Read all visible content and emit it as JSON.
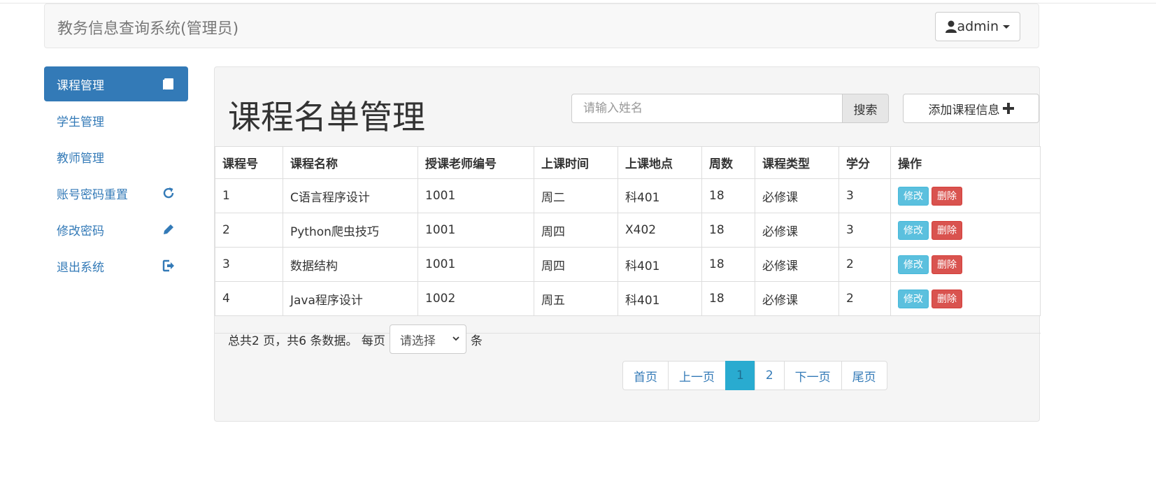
{
  "header": {
    "brand": "教务信息查询系统(管理员)",
    "user_label": "admin"
  },
  "sidebar": {
    "items": [
      {
        "label": "课程管理",
        "icon": "book-icon",
        "active": true
      },
      {
        "label": "学生管理"
      },
      {
        "label": "教师管理"
      },
      {
        "label": "账号密码重置",
        "icon": "refresh-icon"
      },
      {
        "label": "修改密码",
        "icon": "pencil-icon"
      },
      {
        "label": "退出系统",
        "icon": "logout-icon"
      }
    ]
  },
  "main": {
    "title": "课程名单管理",
    "search_placeholder": "请输入姓名",
    "search_button": "搜索",
    "add_button": "添加课程信息"
  },
  "table": {
    "headers": [
      "课程号",
      "课程名称",
      "授课老师编号",
      "上课时间",
      "上课地点",
      "周数",
      "课程类型",
      "学分",
      "操作"
    ],
    "rows": [
      [
        "1",
        "C语言程序设计",
        "1001",
        "周二",
        "科401",
        "18",
        "必修课",
        "3"
      ],
      [
        "2",
        "Python爬虫技巧",
        "1001",
        "周四",
        "X402",
        "18",
        "必修课",
        "3"
      ],
      [
        "3",
        "数据结构",
        "1001",
        "周四",
        "科401",
        "18",
        "必修课",
        "2"
      ],
      [
        "4",
        "Java程序设计",
        "1002",
        "周五",
        "科401",
        "18",
        "必修课",
        "2"
      ]
    ],
    "edit_label": "修改",
    "delete_label": "删除"
  },
  "pager": {
    "summary": "总共2 页，共6 条数据。 每页",
    "select_value": "请选择",
    "unit": "条",
    "pages": [
      "首页",
      "上一页",
      "1",
      "2",
      "下一页",
      "尾页"
    ],
    "current": "1"
  },
  "colors": {
    "primary": "#337ab7",
    "info": "#5bc0de",
    "danger": "#d9534f"
  }
}
